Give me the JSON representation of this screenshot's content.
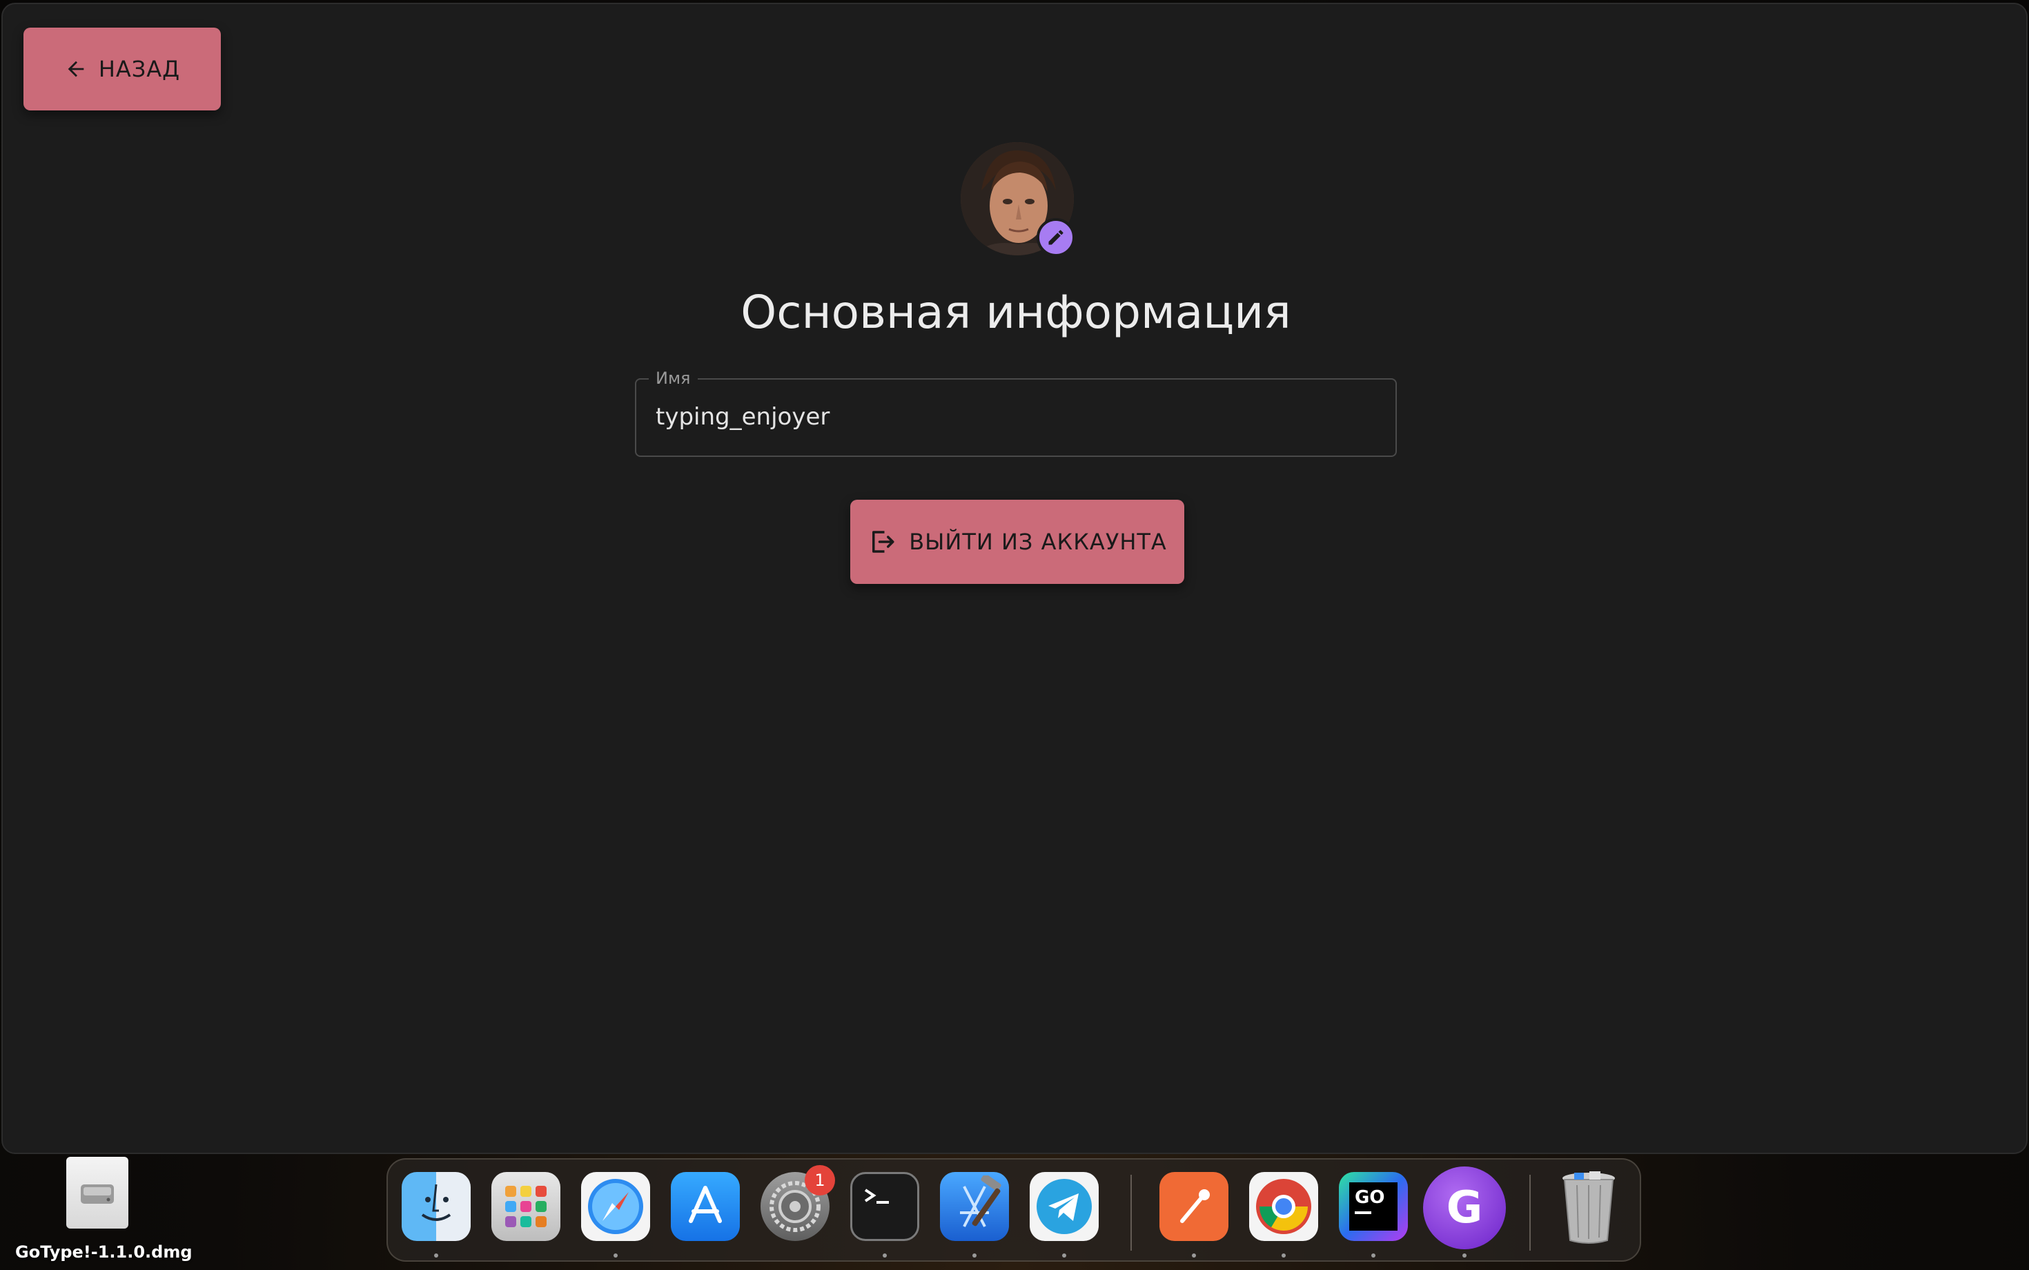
{
  "window": {
    "back_label": "НАЗАД",
    "title": "Основная информация",
    "name_field": {
      "label": "Имя",
      "value": "typing_enjoyer"
    },
    "logout_label": "ВЫЙТИ ИЗ АККАУНТА"
  },
  "colors": {
    "background": "#1c1c1c",
    "button": "#cb6b79",
    "edit_badge": "#a77cf2"
  },
  "dock": {
    "apps": [
      {
        "name": "finder-icon",
        "running": true
      },
      {
        "name": "launchpad-icon",
        "running": false
      },
      {
        "name": "safari-icon",
        "running": true
      },
      {
        "name": "app-store-icon",
        "running": false
      },
      {
        "name": "system-settings-icon",
        "running": false,
        "badge": "1"
      },
      {
        "name": "terminal-icon",
        "running": true
      },
      {
        "name": "xcode-icon",
        "running": true
      },
      {
        "name": "telegram-icon",
        "running": true
      },
      {
        "name": "postman-icon",
        "running": true
      },
      {
        "name": "chrome-icon",
        "running": true
      },
      {
        "name": "goland-icon",
        "running": true
      },
      {
        "name": "gotype-icon",
        "running": true
      },
      {
        "name": "trash-icon",
        "running": false
      }
    ],
    "settings_badge": "1",
    "gotype_letter": "G",
    "goland_text": "GO"
  },
  "desktop": {
    "file_label": "GoType!-1.1.0.dmg"
  }
}
